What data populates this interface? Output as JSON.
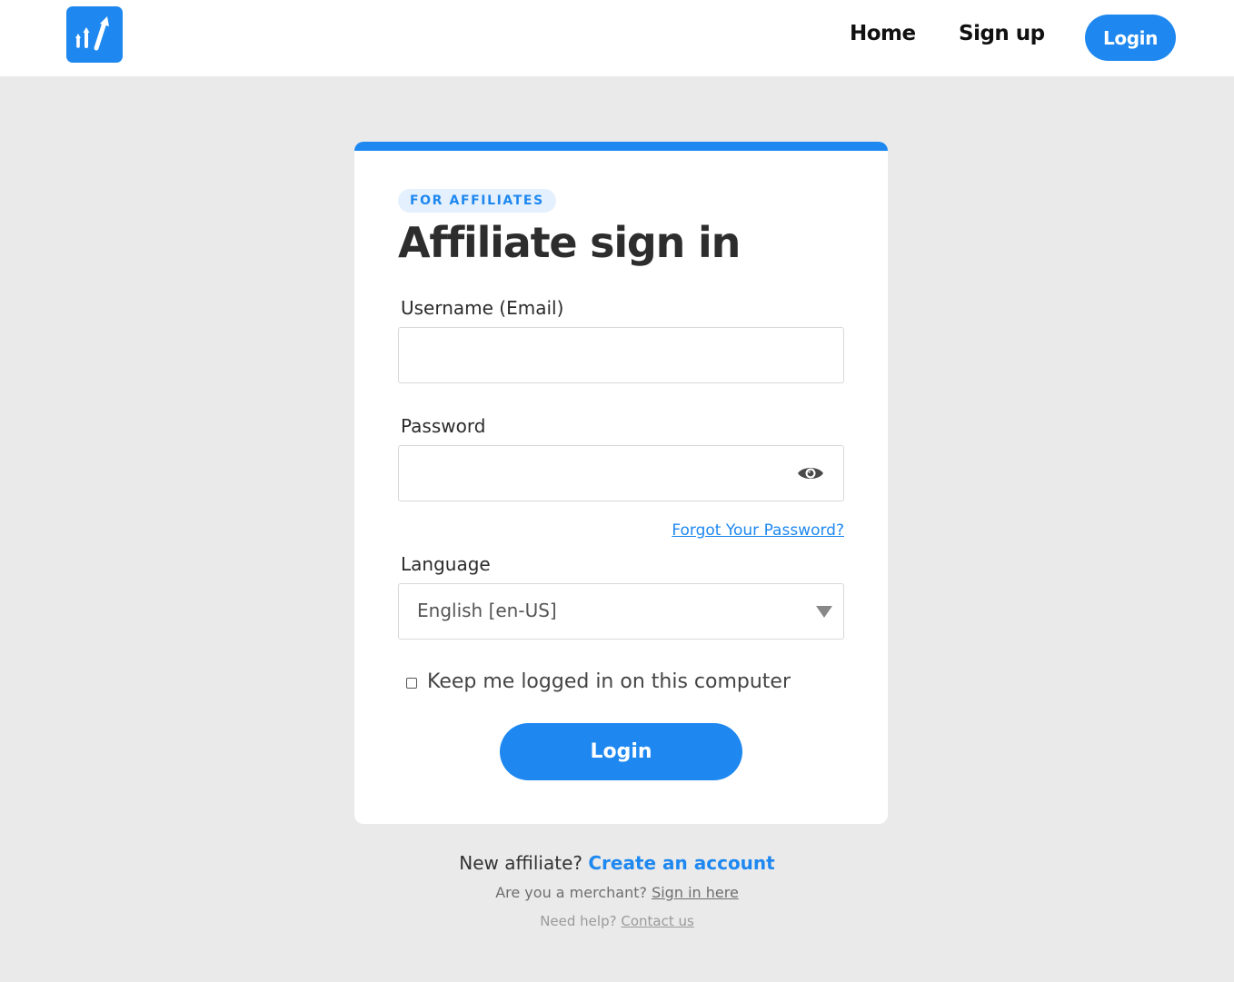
{
  "header": {
    "nav": {
      "home": "Home",
      "signup": "Sign up",
      "login": "Login"
    },
    "logo_icon": "rising-arrows-logo-icon"
  },
  "card": {
    "badge": "FOR AFFILIATES",
    "title": "Affiliate sign in",
    "username_label": "Username (Email)",
    "username_value": "",
    "password_label": "Password",
    "password_value": "",
    "password_toggle_icon": "eye-icon",
    "forgot_link": "Forgot Your Password?",
    "language_label": "Language",
    "language_selected": "English [en-US]",
    "keep_logged_in_label": "Keep me logged in on this computer",
    "keep_logged_in_checked": false,
    "login_button": "Login"
  },
  "footer": {
    "new_affiliate_text": "New affiliate?",
    "create_account_link": "Create an account",
    "merchant_text": "Are you a merchant?",
    "merchant_link": "Sign in here",
    "help_text": "Need help?",
    "help_link": "Contact us"
  },
  "colors": {
    "accent": "#1e88f0",
    "background": "#eaeaea"
  }
}
